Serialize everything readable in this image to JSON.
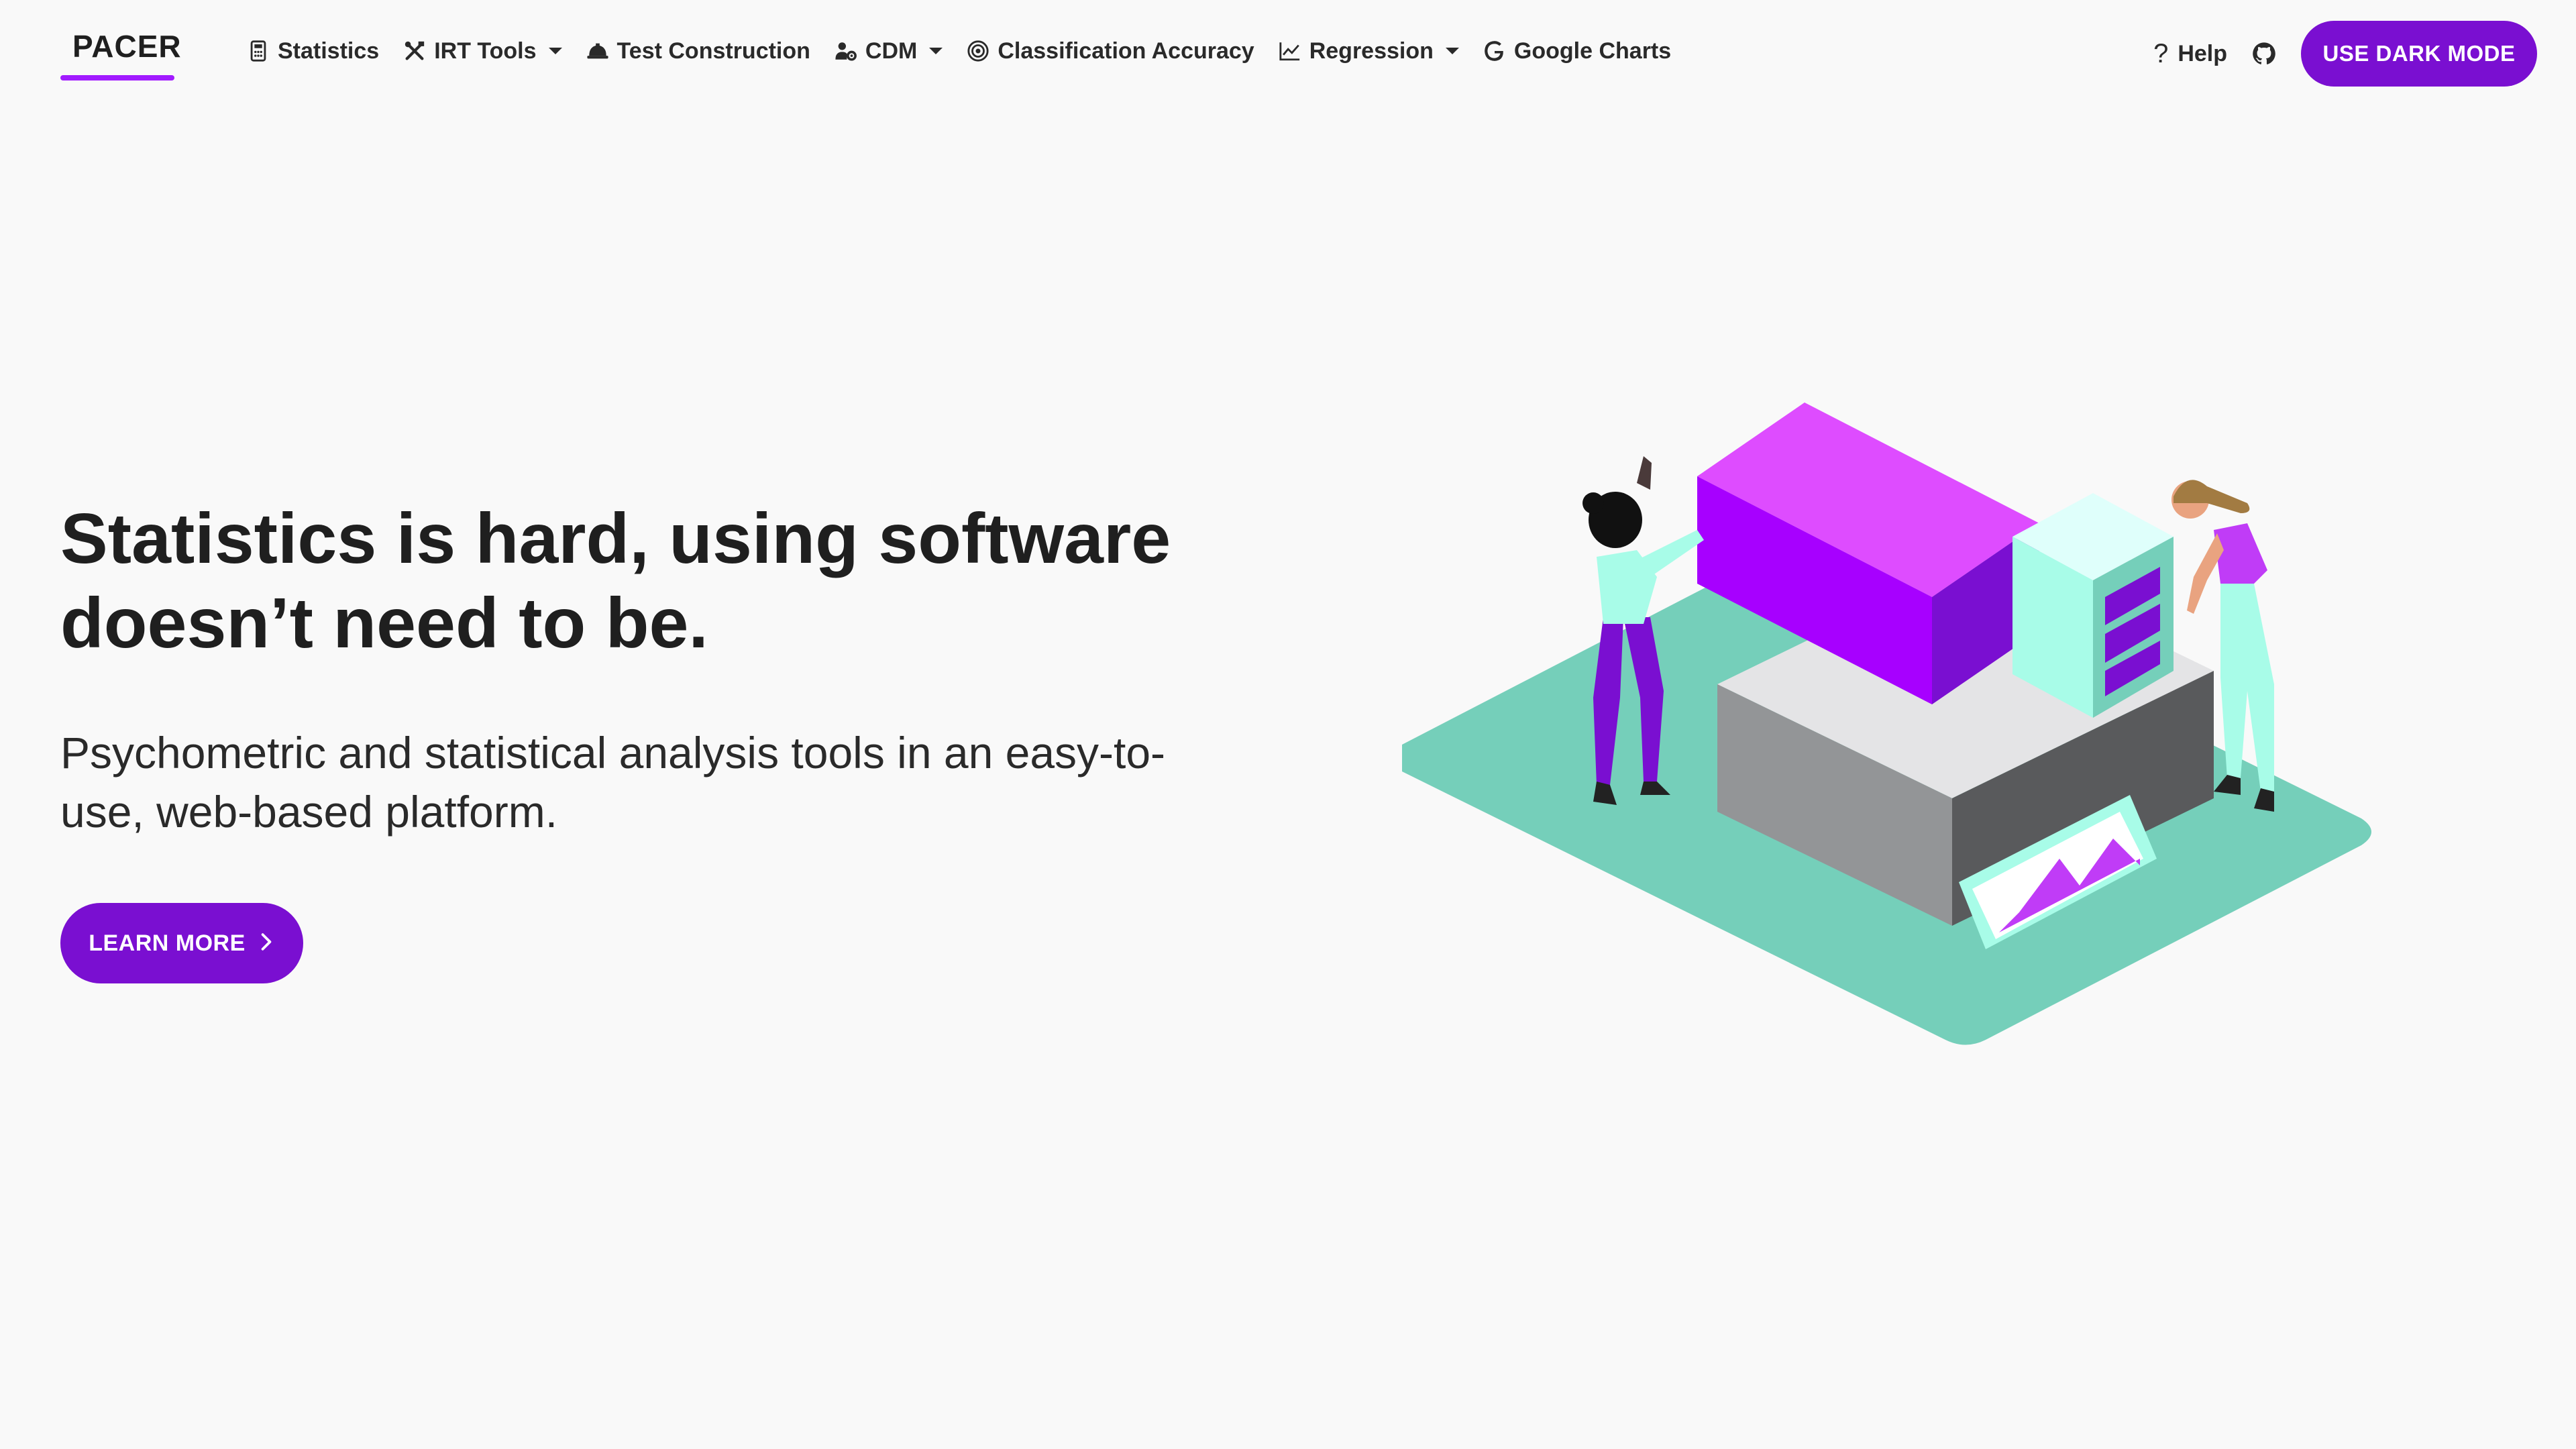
{
  "brand": {
    "name": "PACER"
  },
  "nav": {
    "items": [
      {
        "label": "Statistics",
        "icon": "calculator-icon",
        "dropdown": false
      },
      {
        "label": "IRT Tools",
        "icon": "tools-icon",
        "dropdown": true
      },
      {
        "label": "Test Construction",
        "icon": "hard-hat-icon",
        "dropdown": false
      },
      {
        "label": "CDM",
        "icon": "users-cog-icon",
        "dropdown": true
      },
      {
        "label": "Classification Accuracy",
        "icon": "target-icon",
        "dropdown": false
      },
      {
        "label": "Regression",
        "icon": "line-chart-icon",
        "dropdown": true
      },
      {
        "label": "Google Charts",
        "icon": "google-icon",
        "dropdown": false
      }
    ],
    "help_label": "Help",
    "help_icon": "question-icon",
    "github_icon": "github-icon",
    "dark_mode_label": "USE DARK MODE"
  },
  "hero": {
    "title": "Statistics is hard, using software doesn’t need to be.",
    "subtitle": "Psychometric and statistical analysis tools in an easy-to-use, web-based platform.",
    "cta_label": "LEARN MORE"
  },
  "colors": {
    "accent": "#7a0fd1",
    "brand_underline": "#a21bff",
    "teal": "#75cfba",
    "mint": "#a8fce8",
    "magenta": "#c03cf7"
  }
}
